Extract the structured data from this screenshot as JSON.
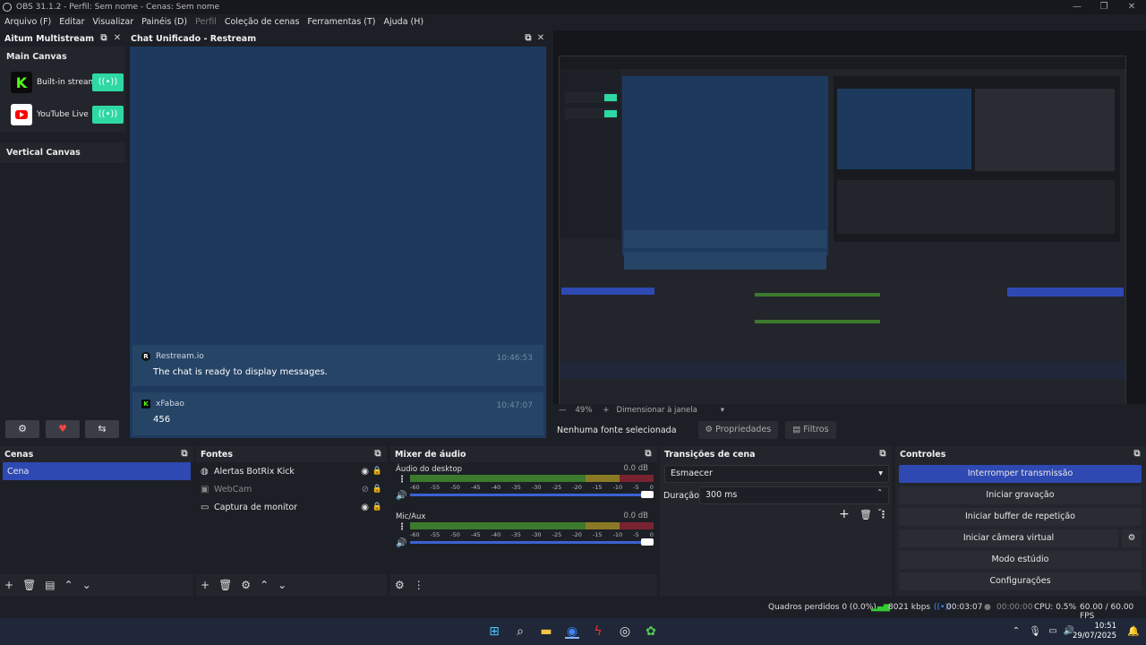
{
  "window": {
    "title": "OBS 31.1.2 - Perfil: Sem nome - Cenas: Sem nome"
  },
  "menu": [
    "Arquivo (F)",
    "Editar",
    "Visualizar",
    "Painéis (D)",
    "Perfil",
    "Coleção de cenas",
    "Ferramentas (T)",
    "Ajuda (H)"
  ],
  "multistream": {
    "title": "Aitum Multistream",
    "main_canvas": "Main Canvas",
    "targets": [
      {
        "name": "Built-in stream",
        "icon": "kick-icon"
      },
      {
        "name": "YouTube Live",
        "icon": "youtube-icon"
      }
    ],
    "vertical_canvas": "Vertical Canvas"
  },
  "chat": {
    "title": "Chat Unificado - Restream",
    "messages": [
      {
        "author": "Restream.io",
        "time": "10:46:53",
        "text": "The chat is ready to display messages."
      },
      {
        "author": "xFabao",
        "time": "10:47:07",
        "text": "456"
      }
    ]
  },
  "preview": {
    "zoom": "49%",
    "fit": "Dimensionar à janela",
    "no_source": "Nenhuma fonte selecionada",
    "properties": "Propriedades",
    "filters": "Filtros"
  },
  "scenes": {
    "title": "Cenas",
    "items": [
      "Cena"
    ]
  },
  "sources": {
    "title": "Fontes",
    "items": [
      {
        "name": "Alertas BotRix Kick",
        "icon": "browser-icon",
        "visible": true
      },
      {
        "name": "WebCam",
        "icon": "camera-icon",
        "visible": false
      },
      {
        "name": "Captura de monitor",
        "icon": "monitor-icon",
        "visible": true
      }
    ]
  },
  "mixer": {
    "title": "Mixer de áudio",
    "scale": [
      "-60",
      "-55",
      "-50",
      "-45",
      "-40",
      "-35",
      "-30",
      "-25",
      "-20",
      "-15",
      "-10",
      "-5",
      "0"
    ],
    "channels": [
      {
        "name": "Áudio do desktop",
        "db": "0.0 dB"
      },
      {
        "name": "Mic/Aux",
        "db": "0.0 dB"
      }
    ]
  },
  "transitions": {
    "title": "Transições de cena",
    "selected": "Esmaecer",
    "duration_label": "Duração",
    "duration": "300 ms"
  },
  "controls": {
    "title": "Controles",
    "buttons": [
      "Interromper transmissão",
      "Iniciar gravação",
      "Iniciar buffer de repetição",
      "Iniciar câmera virtual",
      "Modo estúdio",
      "Configurações"
    ]
  },
  "status": {
    "dropped": "Quadros perdidos 0 (0.0%)",
    "bitrate": "8021 kbps",
    "stream_time": "00:03:07",
    "rec_time": "00:00:00",
    "cpu": "CPU: 0.5%",
    "fps": "60.00 / 60.00 FPS"
  },
  "taskbar": {
    "time": "10:51",
    "date": "29/07/2025"
  },
  "colors": {
    "accent": "#2f49b3",
    "multistream_btn": "#2ed8a3",
    "chat_bg": "#1d3a5e",
    "kick": "#53fc18",
    "youtube": "#ff0000"
  }
}
